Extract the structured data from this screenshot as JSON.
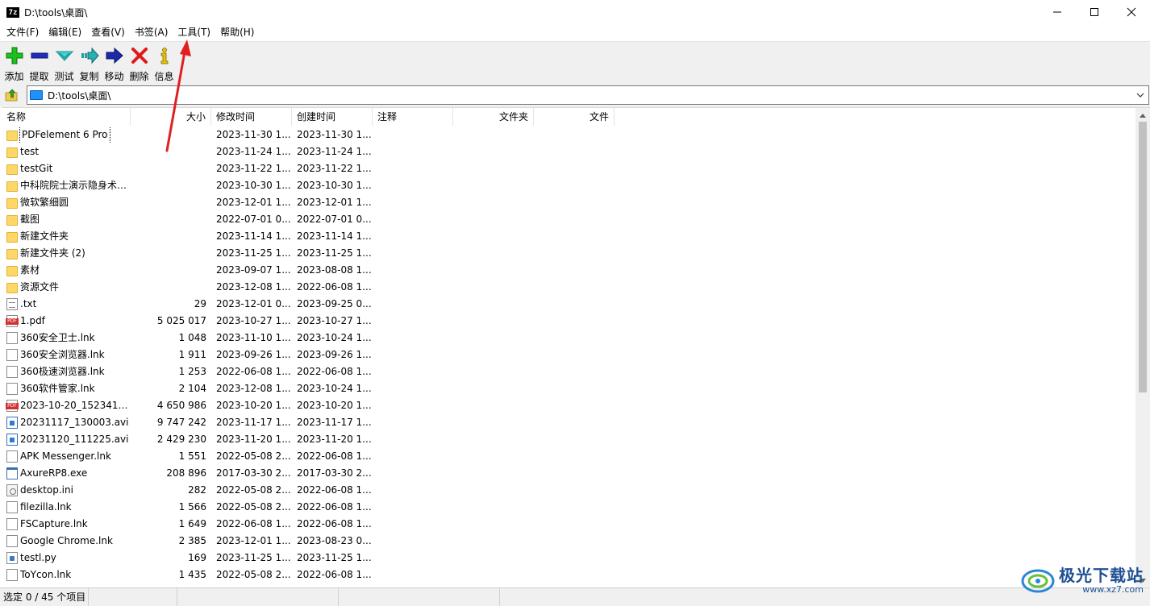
{
  "window": {
    "title": "D:\\tools\\桌面\\",
    "icon_text": "7z"
  },
  "menu": [
    "文件(F)",
    "编辑(E)",
    "查看(V)",
    "书签(A)",
    "工具(T)",
    "帮助(H)"
  ],
  "toolbar": [
    {
      "label": "添加",
      "icon": "add-icon"
    },
    {
      "label": "提取",
      "icon": "extract-icon"
    },
    {
      "label": "测试",
      "icon": "test-icon"
    },
    {
      "label": "复制",
      "icon": "copy-icon"
    },
    {
      "label": "移动",
      "icon": "move-icon"
    },
    {
      "label": "删除",
      "icon": "delete-icon"
    },
    {
      "label": "信息",
      "icon": "info-icon"
    }
  ],
  "address": {
    "path": "D:\\tools\\桌面\\"
  },
  "columns": [
    "名称",
    "大小",
    "修改时间",
    "创建时间",
    "注释",
    "文件夹",
    "文件"
  ],
  "files": [
    {
      "icon": "folder",
      "name": "PDFelement 6 Pro",
      "size": "",
      "modified": "2023-11-30 1...",
      "created": "2023-11-30 1..."
    },
    {
      "icon": "folder",
      "name": "test",
      "size": "",
      "modified": "2023-11-24 1...",
      "created": "2023-11-24 1..."
    },
    {
      "icon": "folder",
      "name": "testGit",
      "size": "",
      "modified": "2023-11-22 1...",
      "created": "2023-11-22 1..."
    },
    {
      "icon": "folder",
      "name": "中科院院士演示隐身术_...",
      "size": "",
      "modified": "2023-10-30 1...",
      "created": "2023-10-30 1..."
    },
    {
      "icon": "folder",
      "name": "微软繁细圆",
      "size": "",
      "modified": "2023-12-01 1...",
      "created": "2023-12-01 1..."
    },
    {
      "icon": "folder",
      "name": "截图",
      "size": "",
      "modified": "2022-07-01 0...",
      "created": "2022-07-01 0..."
    },
    {
      "icon": "folder",
      "name": "新建文件夹",
      "size": "",
      "modified": "2023-11-14 1...",
      "created": "2023-11-14 1..."
    },
    {
      "icon": "folder",
      "name": "新建文件夹 (2)",
      "size": "",
      "modified": "2023-11-25 1...",
      "created": "2023-11-25 1..."
    },
    {
      "icon": "folder",
      "name": "素材",
      "size": "",
      "modified": "2023-09-07 1...",
      "created": "2023-08-08 1..."
    },
    {
      "icon": "folder",
      "name": "资源文件",
      "size": "",
      "modified": "2023-12-08 1...",
      "created": "2022-06-08 1..."
    },
    {
      "icon": "txt",
      "name": ".txt",
      "size": "29",
      "modified": "2023-12-01 0...",
      "created": "2023-09-25 0..."
    },
    {
      "icon": "pdf",
      "name": "1.pdf",
      "size": "5 025 017",
      "modified": "2023-10-27 1...",
      "created": "2023-10-27 1..."
    },
    {
      "icon": "file",
      "name": "360安全卫士.lnk",
      "size": "1 048",
      "modified": "2023-11-10 1...",
      "created": "2023-10-24 1..."
    },
    {
      "icon": "file",
      "name": "360安全浏览器.lnk",
      "size": "1 911",
      "modified": "2023-09-26 1...",
      "created": "2023-09-26 1..."
    },
    {
      "icon": "file",
      "name": "360极速浏览器.lnk",
      "size": "1 253",
      "modified": "2022-06-08 1...",
      "created": "2022-06-08 1..."
    },
    {
      "icon": "file",
      "name": "360软件管家.lnk",
      "size": "2 104",
      "modified": "2023-12-08 1...",
      "created": "2023-10-24 1..."
    },
    {
      "icon": "pdf",
      "name": "2023-10-20_152341.pdf",
      "size": "4 650 986",
      "modified": "2023-10-20 1...",
      "created": "2023-10-20 1..."
    },
    {
      "icon": "avi",
      "name": "20231117_130003.avi",
      "size": "9 747 242",
      "modified": "2023-11-17 1...",
      "created": "2023-11-17 1..."
    },
    {
      "icon": "avi",
      "name": "20231120_111225.avi",
      "size": "2 429 230",
      "modified": "2023-11-20 1...",
      "created": "2023-11-20 1..."
    },
    {
      "icon": "file",
      "name": "APK Messenger.lnk",
      "size": "1 551",
      "modified": "2022-05-08 2...",
      "created": "2022-06-08 1..."
    },
    {
      "icon": "exe",
      "name": "AxureRP8.exe",
      "size": "208 896",
      "modified": "2017-03-30 2...",
      "created": "2017-03-30 2..."
    },
    {
      "icon": "ini",
      "name": "desktop.ini",
      "size": "282",
      "modified": "2022-05-08 2...",
      "created": "2022-06-08 1..."
    },
    {
      "icon": "file",
      "name": "filezilla.lnk",
      "size": "1 566",
      "modified": "2022-05-08 2...",
      "created": "2022-06-08 1..."
    },
    {
      "icon": "file",
      "name": "FSCapture.lnk",
      "size": "1 649",
      "modified": "2022-06-08 1...",
      "created": "2022-06-08 1..."
    },
    {
      "icon": "file",
      "name": "Google Chrome.lnk",
      "size": "2 385",
      "modified": "2023-12-01 1...",
      "created": "2023-08-23 0..."
    },
    {
      "icon": "py",
      "name": "testl.py",
      "size": "169",
      "modified": "2023-11-25 1...",
      "created": "2023-11-25 1..."
    },
    {
      "icon": "file",
      "name": "ToYcon.lnk",
      "size": "1 435",
      "modified": "2022-05-08 2...",
      "created": "2022-06-08 1..."
    }
  ],
  "status": {
    "selection": "选定 0 / 45 个项目"
  },
  "watermark": {
    "name": "极光下载站",
    "url": "www.xz7.com"
  },
  "colors": {
    "annotation_arrow": "#e02020",
    "folder": "#ffd766",
    "toolbar_bg": "#f0f0f0"
  }
}
